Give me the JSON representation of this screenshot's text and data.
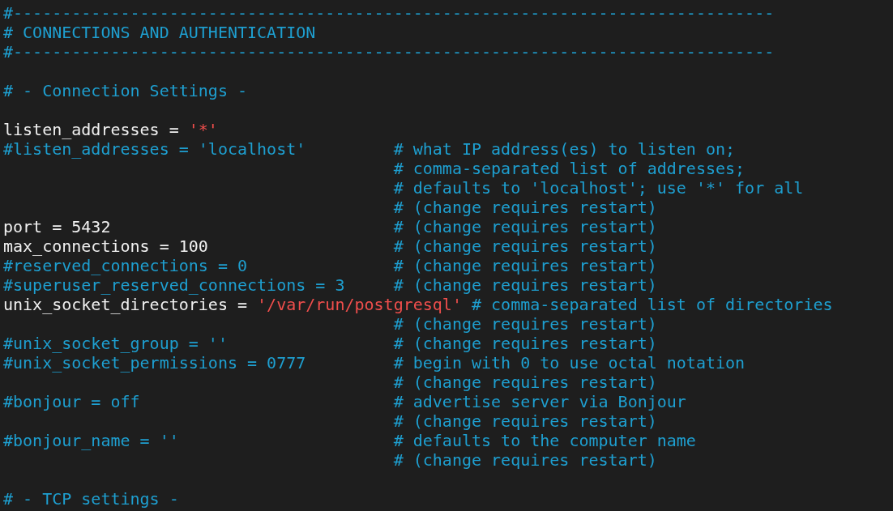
{
  "lines": [
    {
      "kind": "text",
      "code": [
        {
          "kind": "comment",
          "text": "#------------------------------------------------------------------------------"
        }
      ]
    },
    {
      "kind": "text",
      "code": [
        {
          "kind": "comment",
          "text": "# CONNECTIONS AND AUTHENTICATION"
        }
      ]
    },
    {
      "kind": "text",
      "code": [
        {
          "kind": "comment",
          "text": "#------------------------------------------------------------------------------"
        }
      ]
    },
    {
      "kind": "blank"
    },
    {
      "kind": "text",
      "code": [
        {
          "kind": "comment",
          "text": "# - Connection Settings -"
        }
      ]
    },
    {
      "kind": "blank"
    },
    {
      "kind": "text",
      "code": [
        {
          "kind": "plain",
          "text": "listen_addresses = "
        },
        {
          "kind": "string",
          "text": "'*'"
        }
      ]
    },
    {
      "kind": "text",
      "code": [
        {
          "kind": "comment",
          "text": "#listen_addresses = 'localhost'"
        }
      ],
      "comment": "# what IP address(es) to listen on;"
    },
    {
      "kind": "text",
      "comment": "# comma-separated list of addresses;"
    },
    {
      "kind": "text",
      "comment": "# defaults to 'localhost'; use '*' for all"
    },
    {
      "kind": "text",
      "comment": "# (change requires restart)"
    },
    {
      "kind": "text",
      "code": [
        {
          "kind": "plain",
          "text": "port = 5432"
        }
      ],
      "comment": "# (change requires restart)"
    },
    {
      "kind": "text",
      "code": [
        {
          "kind": "plain",
          "text": "max_connections = 100"
        }
      ],
      "comment": "# (change requires restart)"
    },
    {
      "kind": "text",
      "code": [
        {
          "kind": "comment",
          "text": "#reserved_connections = 0"
        }
      ],
      "comment": "# (change requires restart)"
    },
    {
      "kind": "text",
      "code": [
        {
          "kind": "comment",
          "text": "#superuser_reserved_connections = 3"
        }
      ],
      "comment": "# (change requires restart)"
    },
    {
      "kind": "text",
      "code": [
        {
          "kind": "plain",
          "text": "unix_socket_directories = "
        },
        {
          "kind": "string",
          "text": "'/var/run/postgresql'"
        }
      ],
      "comment": "# comma-separated list of directories"
    },
    {
      "kind": "text",
      "comment": "# (change requires restart)"
    },
    {
      "kind": "text",
      "code": [
        {
          "kind": "comment",
          "text": "#unix_socket_group = ''"
        }
      ],
      "comment": "# (change requires restart)"
    },
    {
      "kind": "text",
      "code": [
        {
          "kind": "comment",
          "text": "#unix_socket_permissions = 0777"
        }
      ],
      "comment": "# begin with 0 to use octal notation"
    },
    {
      "kind": "text",
      "comment": "# (change requires restart)"
    },
    {
      "kind": "text",
      "code": [
        {
          "kind": "comment",
          "text": "#bonjour = off"
        }
      ],
      "comment": "# advertise server via Bonjour"
    },
    {
      "kind": "text",
      "comment": "# (change requires restart)"
    },
    {
      "kind": "text",
      "code": [
        {
          "kind": "comment",
          "text": "#bonjour_name = ''"
        }
      ],
      "comment": "# defaults to the computer name"
    },
    {
      "kind": "text",
      "comment": "# (change requires restart)"
    },
    {
      "kind": "blank"
    },
    {
      "kind": "text",
      "code": [
        {
          "kind": "comment",
          "text": "# - TCP settings -"
        }
      ]
    }
  ]
}
